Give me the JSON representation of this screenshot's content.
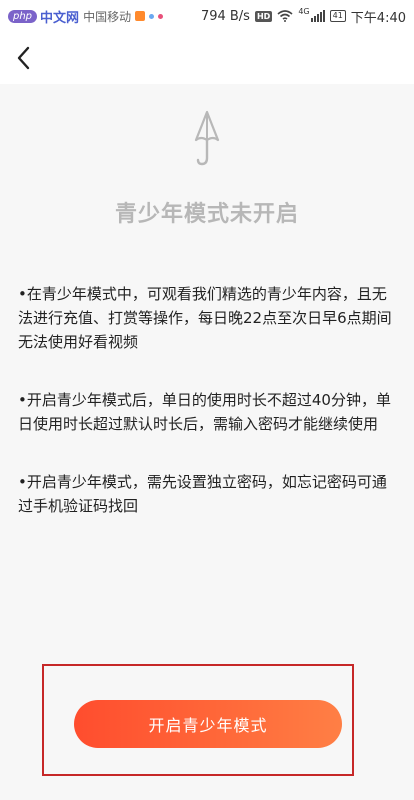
{
  "status_bar": {
    "watermark_badge": "php",
    "watermark_text": "中文网",
    "carrier": "中国移动",
    "net_speed": "794 B/s",
    "hd_label": "HD",
    "network_type": "4G",
    "battery": "41",
    "time": "下午4:40"
  },
  "nav": {
    "back_icon": "chevron-left-icon"
  },
  "hero": {
    "icon": "umbrella-icon",
    "title": "青少年模式未开启"
  },
  "bullets": [
    "在青少年模式中，可观看我们精选的青少年内容，且无法进行充值、打赏等操作，每日晚22点至次日早6点期间无法使用好看视频",
    "开启青少年模式后，单日的使用时长不超过40分钟，单日使用时长超过默认时长后，需输入密码才能继续使用",
    "开启青少年模式，需先设置独立密码，如忘记密码可通过手机验证码找回"
  ],
  "bullet_marker": "•",
  "action": {
    "enable_label": "开启青少年模式"
  },
  "colors": {
    "button_start": "#ff4d2e",
    "button_end": "#ff7f45",
    "highlight_border": "#c62828",
    "title_gray": "#b7b7b7"
  }
}
